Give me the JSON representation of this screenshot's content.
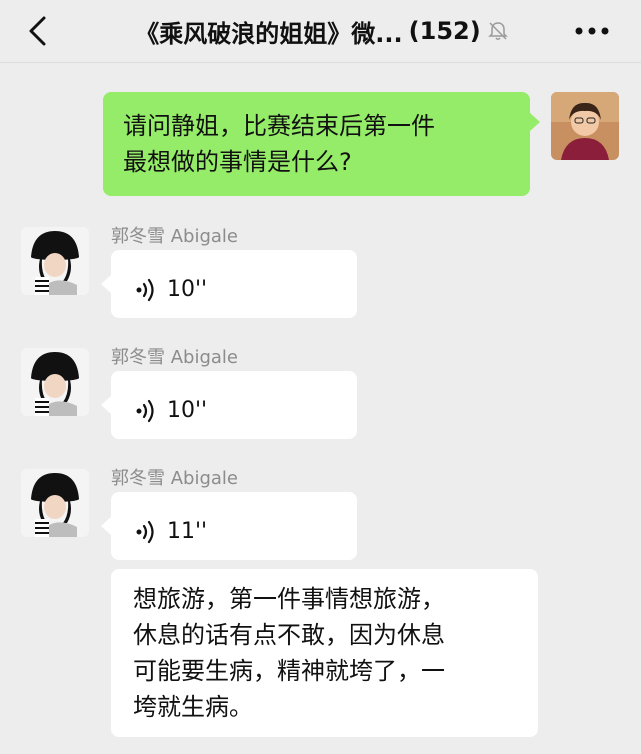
{
  "header": {
    "title": "《乘风破浪的姐姐》微...",
    "member_count": "(152)",
    "back_icon": "chevron-left-icon",
    "mute_icon": "bell-off-icon",
    "more_icon": "more-dots-icon"
  },
  "colors": {
    "sent_bubble": "#95ec69",
    "received_bubble": "#ffffff",
    "background": "#ededed",
    "sender_name": "#8c8c8c"
  },
  "messages": [
    {
      "direction": "sent",
      "text_lines": [
        "请问静姐，比赛结束后第一件",
        "最想做的事情是什么?"
      ]
    },
    {
      "direction": "received",
      "sender": "郭冬雪 Abigale",
      "type": "voice",
      "duration": "10''"
    },
    {
      "direction": "received",
      "sender": "郭冬雪 Abigale",
      "type": "voice",
      "duration": "10''"
    },
    {
      "direction": "received",
      "sender": "郭冬雪 Abigale",
      "type": "voice",
      "duration": "11''"
    },
    {
      "direction": "received",
      "type": "text",
      "text_lines": [
        "想旅游，第一件事情想旅游，",
        "休息的话有点不敢，因为休息",
        "可能要生病，精神就垮了，一",
        "垮就生病。"
      ]
    }
  ]
}
